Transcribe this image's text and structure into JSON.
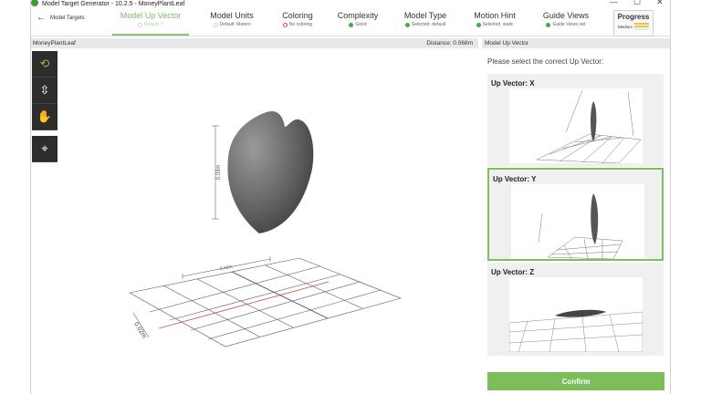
{
  "window": {
    "title": "Model Target Generator - 10.2.5 - MoneyPlantLeaf",
    "minimize": "—",
    "maximize": "☐",
    "close": "✕"
  },
  "nav": {
    "back_label": "Model Targets",
    "steps": [
      {
        "label": "Model Up Vector",
        "status": "Default: Y",
        "dot_color": "#cfcfcf",
        "active": true
      },
      {
        "label": "Model Units",
        "status": "Default: Meters",
        "dot_color": "#cfcfcf"
      },
      {
        "label": "Coloring",
        "status": "No coloring",
        "dot_color": "#d94a4a"
      },
      {
        "label": "Complexity",
        "status": "Good",
        "dot_color": "#3fae49"
      },
      {
        "label": "Model Type",
        "status": "Selected: default",
        "dot_color": "#3fae49"
      },
      {
        "label": "Motion Hint",
        "status": "Selected: static",
        "dot_color": "#3fae49"
      },
      {
        "label": "Guide Views",
        "status": "Guide Views set",
        "dot_color": "#3fae49"
      }
    ],
    "progress": {
      "label": "Progress",
      "level": "Medium"
    }
  },
  "viewport": {
    "model_name": "MoneyPlantLeaf",
    "distance": "Distance: 0.068m",
    "height_label": "0.03m",
    "width_label": "0.02m",
    "depth_label": "0.02m",
    "tools": [
      {
        "name": "rotate-icon",
        "glyph": "⟲"
      },
      {
        "name": "vertical-move-icon",
        "glyph": "⇳"
      },
      {
        "name": "pan-hand-icon",
        "glyph": "✋"
      },
      {
        "name": "center-target-icon",
        "glyph": "⌖"
      }
    ]
  },
  "panel": {
    "title": "Model Up Vector",
    "prompt": "Please select the correct Up Vector:",
    "options": [
      {
        "label": "Up Vector: X",
        "selected": false
      },
      {
        "label": "Up Vector: Y",
        "selected": true
      },
      {
        "label": "Up Vector: Z",
        "selected": false
      }
    ],
    "confirm_label": "Confirm"
  },
  "colors": {
    "accent": "#7dbe5c",
    "error": "#d94a4a",
    "ok": "#3fae49"
  }
}
